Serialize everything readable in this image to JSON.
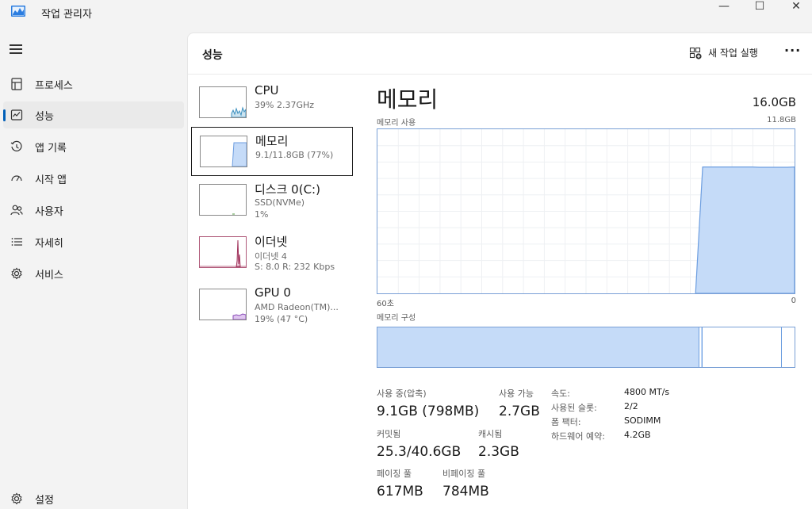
{
  "window": {
    "title": "작업 관리자",
    "minimize": "—",
    "maximize": "☐",
    "close": "✕"
  },
  "nav": {
    "items": [
      {
        "label": "프로세스",
        "icon": "processes-icon"
      },
      {
        "label": "성능",
        "icon": "performance-icon",
        "active": true
      },
      {
        "label": "앱 기록",
        "icon": "app-history-icon"
      },
      {
        "label": "시작 앱",
        "icon": "startup-apps-icon"
      },
      {
        "label": "사용자",
        "icon": "users-icon"
      },
      {
        "label": "자세히",
        "icon": "details-icon"
      },
      {
        "label": "서비스",
        "icon": "services-icon"
      }
    ],
    "settings": "설정"
  },
  "header": {
    "title": "성능",
    "run_new_task": "새 작업 실행",
    "more": "···"
  },
  "devices": [
    {
      "name": "CPU",
      "sub1": "39%  2.37GHz",
      "sub2": ""
    },
    {
      "name": "메모리",
      "sub1": "9.1/11.8GB (77%)",
      "sub2": ""
    },
    {
      "name": "디스크 0(C:)",
      "sub1": "SSD(NVMe)",
      "sub2": "1%"
    },
    {
      "name": "이더넷",
      "sub1": "이더넷 4",
      "sub2": "S: 8.0  R: 232 Kbps"
    },
    {
      "name": "GPU 0",
      "sub1": "AMD Radeon(TM)...",
      "sub2": "19%  (47 °C)"
    }
  ],
  "detail": {
    "title": "메모리",
    "total": "16.0GB",
    "usage_label": "메모리 사용",
    "usage_max": "11.8GB",
    "axis_left": "60초",
    "axis_right": "0",
    "composition_label": "메모리 구성",
    "chart_color": "#c5dbf8",
    "chart_stroke": "#6d9ee0",
    "usage_series_fraction": [
      0,
      0,
      0,
      0,
      0,
      0,
      0,
      0,
      0,
      0,
      0,
      0,
      0,
      0,
      0,
      0,
      0,
      0,
      0,
      0,
      0,
      0,
      0,
      0,
      0,
      0,
      0,
      0,
      0,
      0,
      0,
      0,
      0,
      0,
      0,
      0,
      0,
      0,
      0,
      0,
      0,
      0,
      0,
      0,
      0,
      0,
      0.77,
      0.77,
      0.77,
      0.77,
      0.77,
      0.77,
      0.77,
      0.77,
      0.768,
      0.768,
      0.768,
      0.768,
      0.768,
      0.77
    ]
  },
  "stats": {
    "in_use_label": "사용 중(압축)",
    "in_use_value": "9.1GB (798MB)",
    "available_label": "사용 가능",
    "available_value": "2.7GB",
    "committed_label": "커밋됨",
    "committed_value": "25.3/40.6GB",
    "cached_label": "캐시됨",
    "cached_value": "2.3GB",
    "paged_label": "페이징 풀",
    "paged_value": "617MB",
    "nonpaged_label": "비페이징 풀",
    "nonpaged_value": "784MB"
  },
  "specs": [
    {
      "key": "속도:",
      "value": "4800 MT/s"
    },
    {
      "key": "사용된 슬롯:",
      "value": "2/2"
    },
    {
      "key": "폼 팩터:",
      "value": "SODIMM"
    },
    {
      "key": "하드웨어 예약:",
      "value": "4.2GB"
    }
  ]
}
